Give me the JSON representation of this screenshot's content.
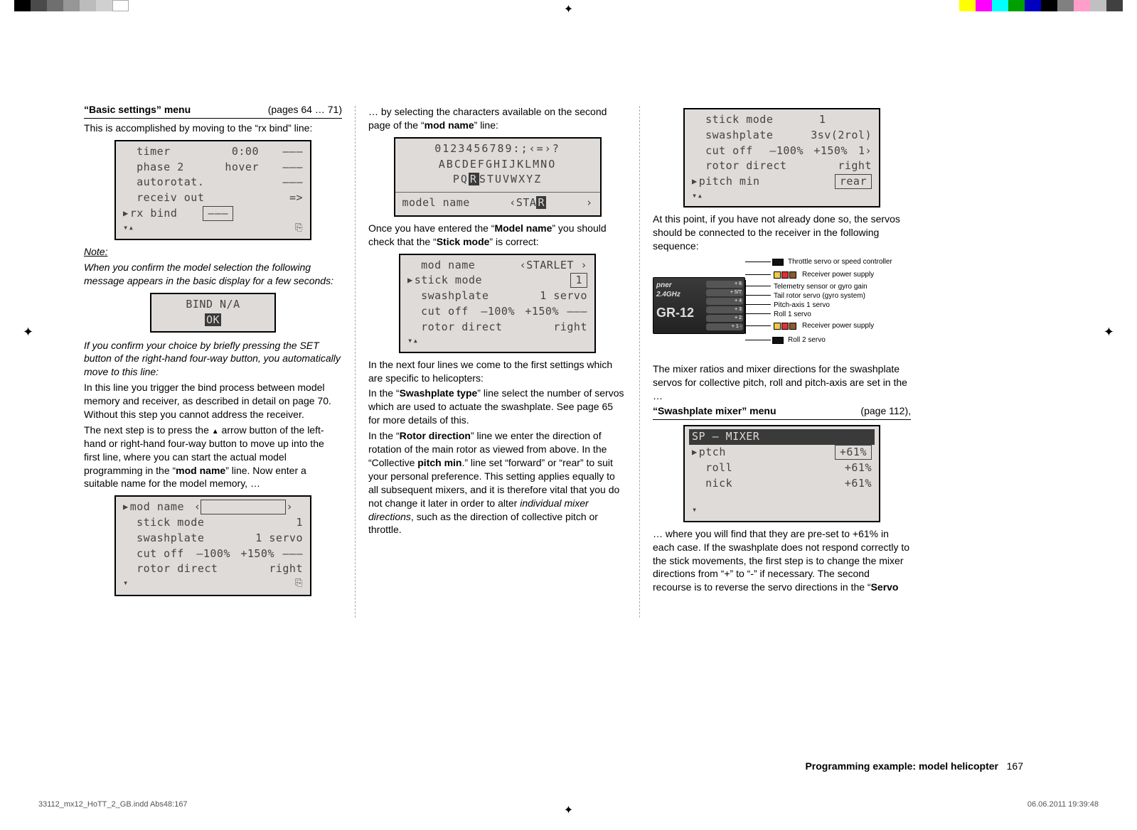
{
  "print_colors_left": [
    "#000",
    "#4a4a4a",
    "#6f6f6f",
    "#969696",
    "#bcbcbc",
    "#d0d0d0",
    "#ffffff"
  ],
  "print_colors_right": [
    "#ffff00",
    "#ff00ff",
    "#00ffff",
    "#00a000",
    "#0000c0",
    "#000000",
    "#808080",
    "#ff9ec8",
    "#c0c0c0",
    "#404040"
  ],
  "col1": {
    "header_left": "“Basic settings” menu",
    "header_right": "(pages 64 … 71)",
    "intro": "This is accomplished by moving to the “rx bind” line:",
    "lcd1": {
      "timer_label": "timer",
      "timer_val": "0:00",
      "timer_sw": "–––",
      "phase_label": "phase 2",
      "phase_val": "hover",
      "phase_sw": "–––",
      "auto_label": "autorotat.",
      "auto_sw": "–––",
      "recv_label": "receiv out",
      "recv_val": "=>",
      "rx_label": "rx  bind",
      "rx_box": "–––"
    },
    "note_title": "Note:",
    "note_body": "When you confirm the model selection the following message appears in the basic display for a few seconds:",
    "bind_box_line1": "BIND N/A",
    "bind_box_ok": "OK",
    "para2": "If you confirm your choice by briefly pressing the SET button of the right-hand four-way button, you automatically move to this line:",
    "para3": "In this line you trigger the bind process between model memory and receiver, as described in detail on page 70. Without this step you cannot address the receiver.",
    "para4_pre": "The next step is to press the ",
    "para4_post": " arrow button of the left-hand or right-hand four-way button to move up into the first line, where you can start the actual model programming in the “",
    "para4_bold": "mod name",
    "para4_tail": "” line. Now enter a suitable name for the model memory, …",
    "lcd2": {
      "mod_label": "mod name",
      "stick_label": "stick mode",
      "stick_val": "1",
      "swash_label": "swashplate",
      "swash_val": "1 servo",
      "cut_label": "cut off",
      "cut_lo": "–100%",
      "cut_hi": "+150%",
      "cut_sw": "–––",
      "rotor_label": "rotor direct",
      "rotor_val": "right"
    }
  },
  "col2": {
    "intro_a": "… by selecting the characters available on the second page of the “",
    "intro_bold": "mod name",
    "intro_b": "” line:",
    "charmap": {
      "line1": "0123456789:;‹=›?",
      "line2": " ABCDEFGHIJKLMNO",
      "line3_a": "PQ",
      "line3_hi": "R",
      "line3_b": "STUVWXYZ",
      "bottom_label": "model name",
      "bottom_val_a": "‹STA",
      "bottom_hi": "R",
      "bottom_val_b": "›"
    },
    "para1_a": "Once you have entered the “",
    "para1_b1": "Model name",
    "para1_c": "” you should check that the “",
    "para1_b2": "Stick mode",
    "para1_d": "” is correct:",
    "lcd3": {
      "mod_label": "mod name",
      "mod_val": "‹STARLET ›",
      "stick_label": "stick mode",
      "stick_box": "1",
      "swash_label": "swashplate",
      "swash_val": "1 servo",
      "cut_label": "cut off",
      "cut_lo": "–100%",
      "cut_hi": "+150%",
      "cut_sw": "–––",
      "rotor_label": "rotor direct",
      "rotor_val": "right"
    },
    "para2": "In the next four lines we come to the first settings which are specific to helicopters:",
    "para3_a": "In the “",
    "para3_b": "Swashplate type",
    "para3_c": "” line select the number of servos which are used to actuate the swashplate. See page 65 for more details of this.",
    "para4_a": "In the “",
    "para4_b": "Rotor direction",
    "para4_c": "” line we enter the direction of rotation of the main rotor as viewed from above. In the “Collective ",
    "para4_b2": "pitch min",
    "para4_d": ".” line set “forward” or “rear” to suit your personal preference. This setting applies equally to all subsequent mixers, and it is therefore vital that you do not change it later in order to alter ",
    "para4_i": "individual mixer directions",
    "para4_e": ", such as the direction of collective pitch or throttle."
  },
  "col3": {
    "lcd4": {
      "stick_label": "stick mode",
      "stick_val": "1",
      "swash_label": "swashplate",
      "swash_val": "3sv(2rol)",
      "cut_label": "cut off",
      "cut_lo": "–100%",
      "cut_hi": "+150%",
      "cut_sw": "1›",
      "rotor_label": "rotor direct",
      "rotor_val": "right",
      "pitch_label": "pitch min",
      "pitch_box": "rear"
    },
    "para1": "At this point, if you have not already done so, the servos should be connected to the receiver in the following sequence:",
    "diagram_labels": {
      "top": "Throttle servo or speed controller",
      "rps1": "Receiver power supply",
      "tele": "Telemetry sensor or gyro gain",
      "tail": "Tail rotor servo (gyro system)",
      "pitch": "Pitch-axis 1 servo",
      "roll1": "Roll 1 servo",
      "rps2": "Receiver power supply",
      "roll2": "Roll 2 servo",
      "brand": "pner",
      "ghz": "2.4GHz",
      "model": "GR-12"
    },
    "para2": "The mixer ratios and mixer directions for the swashplate servos for collective pitch, roll and pitch-axis are set in the …",
    "hdr2_left": "“Swashplate mixer” menu",
    "hdr2_right": "(page 112),",
    "lcd5": {
      "title": "SP – MIXER",
      "ptch_label": "ptch",
      "ptch_val": "+61%",
      "roll_label": "roll",
      "roll_val": "+61%",
      "nick_label": "nick",
      "nick_val": "+61%"
    },
    "para3_a": "… where you will find that they are pre-set to +61% in each case. If the swashplate does not respond correctly to the stick movements, the first step is to change the mixer directions from “+” to “-” if necessary. The second recourse is to reverse the servo directions in the “",
    "para3_b": "Servo"
  },
  "footer": {
    "title": "Programming example: model helicopter",
    "page": "167",
    "imprint_left": "33112_mx12_HoTT_2_GB.indd   Abs48:167",
    "imprint_right": "06.06.2011   19:39:48"
  }
}
